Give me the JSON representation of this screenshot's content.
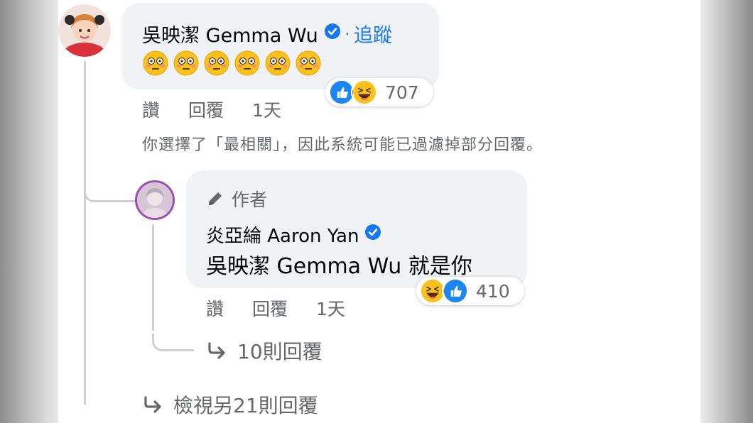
{
  "comment": {
    "author": "吳映潔 Gemma Wu",
    "follow_label": "追蹤",
    "separator": "·",
    "emoji_text": "😳😳😳😳😳😳",
    "reactions_count": "707",
    "actions": {
      "like": "讚",
      "reply": "回覆",
      "time": "1天"
    }
  },
  "notice": "你選擇了「最相關」，因此系統可能已過濾掉部分回覆。",
  "reply": {
    "badge": "作者",
    "author": "炎亞綸 Aaron Yan",
    "text": "吳映潔 Gemma Wu 就是你",
    "reactions_count": "410",
    "actions": {
      "like": "讚",
      "reply": "回覆",
      "time": "1天"
    },
    "more_replies": "10則回覆"
  },
  "view_more": "檢視另21則回覆",
  "colors": {
    "accent": "#1877f2",
    "bubble": "#f0f2f5",
    "muted": "#65676b",
    "verified": "#1877f2"
  },
  "icons": [
    "verified-badge-icon",
    "flushed-emoji-icon",
    "like-reaction-icon",
    "haha-reaction-icon",
    "pencil-icon",
    "reply-arrow-icon"
  ]
}
